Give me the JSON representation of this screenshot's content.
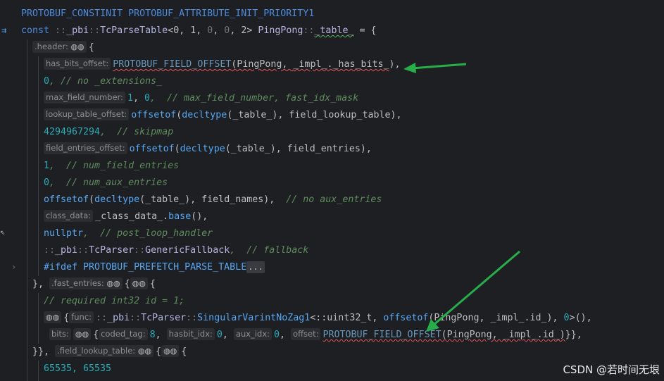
{
  "code": {
    "line0": "PROTOBUF_CONSTINIT PROTOBUF_ATTRIBUTE_INIT_PRIORITY1",
    "line1_const": "const ",
    "line1_ns1": "::",
    "line1_pbi": "_pbi",
    "line1_sep": "::",
    "line1_tpt": "TcParseTable",
    "line1_lt": "<",
    "line1_a0": "0",
    "line1_c1": ", ",
    "line1_a1": "1",
    "line1_c2": ", ",
    "line1_a2": "0",
    "line1_c3": ", ",
    "line1_a3": "0",
    "line1_c4": ", ",
    "line1_a4": "2",
    "line1_gt": "> ",
    "line1_cls": "PingPong",
    "line1_sep2": "::",
    "line1_tbl": "_table_",
    "line1_eq": " = {",
    "line2_hint": ".header:",
    "line2_brace": "{",
    "line3_hint": "has_bits_offset:",
    "line3_macro": "PROTOBUF_FIELD_OFFSET",
    "line3_rest1": "(PingPong, ",
    "line3_rest2": "_impl_",
    "line3_rest3": ".",
    "line3_rest4": "_has_bits_",
    "line3_rest5": "),",
    "line4_num": "0",
    "line4_cmt": ", // no _extensions_",
    "line5_hint": "max_field_number:",
    "line5_n1": "1",
    "line5_c": ", ",
    "line5_n2": "0",
    "line5_cmt": ",  // max_field_number, fast_idx_mask",
    "line6_hint": "lookup_table_offset:",
    "line6_fn": "offsetof",
    "line6_p1": "(",
    "line6_kw": "decltype",
    "line6_p2": "(_table_), field_lookup_table),",
    "line7_num": "4294967294",
    "line7_cmt": ",  // skipmap",
    "line8_hint": "field_entries_offset:",
    "line8_fn": "offsetof",
    "line8_p1": "(",
    "line8_kw": "decltype",
    "line8_p2": "(_table_), field_entries),",
    "line9_num": "1",
    "line9_cmt": ",  // num_field_entries",
    "line10_num": "0",
    "line10_cmt": ",  // num_aux_entries",
    "line11_fn": "offsetof",
    "line11_p1": "(",
    "line11_kw": "decltype",
    "line11_p2": "(_table_), field_names),",
    "line11_cmt": "  // no aux_entries",
    "line12_hint": "class_data:",
    "line12_a": "_class_data_",
    "line12_b": ".",
    "line12_c": "base",
    "line12_d": "(),",
    "line13_kw": "nullptr",
    "line13_cmt": ",  // post_loop_handler",
    "line14_ns": "::",
    "line14_pbi": "_pbi",
    "line14_s1": "::",
    "line14_tc": "TcParser",
    "line14_s2": "::",
    "line14_fb": "GenericFallback",
    "line14_cmt": ",  // fallback",
    "line15_pre": "#ifdef ",
    "line15_mac": "PROTOBUF_PREFETCH_PARSE_TABLE",
    "line15_fold": "...",
    "line16_close": "},",
    "line16_hint": ".fast_entries:",
    "line16_brace": "{",
    "line16_brace2": "{",
    "line17_cmt": "// required int32 id = 1;",
    "line18_brace": "{",
    "line18_hint": "func:",
    "line18_ns": "::",
    "line18_pbi": "_pbi",
    "line18_s1": "::",
    "line18_tc": "TcParser",
    "line18_s2": "::",
    "line18_fn": "SingularVarintNoZag1",
    "line18_lt": "<::uint32_t, ",
    "line18_off": "offsetof",
    "line18_rest": "(PingPong, _impl_.id_), ",
    "line18_zero": "0",
    "line18_end": ">(),",
    "line19_hint1": "bits:",
    "line19_b1": "{",
    "line19_hint2": "coded_tag:",
    "line19_v1": "8",
    "line19_c1": ", ",
    "line19_hint3": "hasbit_idx:",
    "line19_v2": "0",
    "line19_c2": ", ",
    "line19_hint4": "aux_idx:",
    "line19_v3": "0",
    "line19_c3": ", ",
    "line19_hint5": "offset:",
    "line19_macro": "PROTOBUF_FIELD_OFFSET",
    "line19_rest": "(PingPong, _impl_.id_)",
    "line19_end": "}},",
    "line20_close": "}},",
    "line20_hint": ".field_lookup_table:",
    "line20_brace": "{",
    "line20_brace2": "{",
    "line21": "65535, 65535"
  },
  "gutter_icons": {
    "implements_icon": "⇉",
    "hint_icon": "⇖",
    "fold_icon": "›"
  },
  "watermark": "CSDN @若时间无垠",
  "colors": {
    "background": "#1e1f22",
    "arrow": "#27ae4a"
  }
}
